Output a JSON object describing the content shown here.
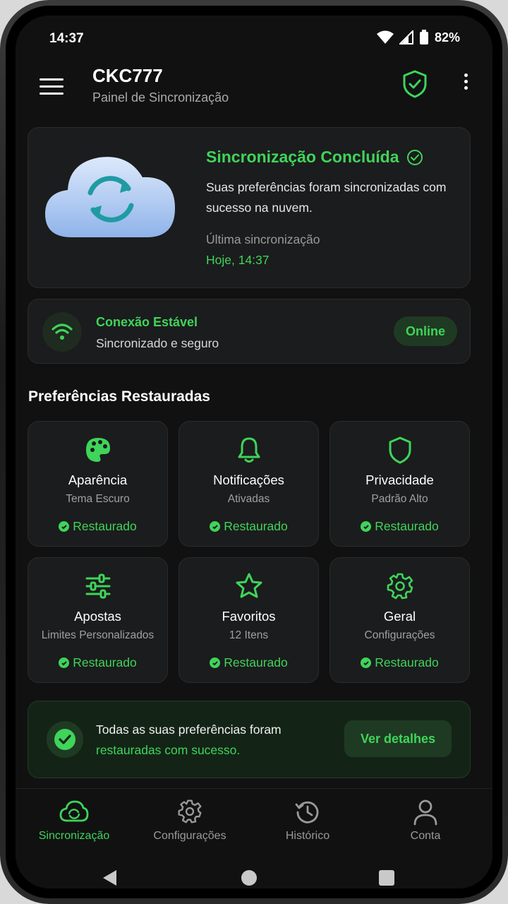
{
  "status_bar": {
    "time": "14:37",
    "battery": "82%"
  },
  "app_bar": {
    "title": "CKC777",
    "subtitle": "Painel de Sincronização"
  },
  "hero": {
    "title": "Sincronização Concluída",
    "description": "Suas preferências foram sincronizadas com sucesso na nuvem.",
    "last_sync_label": "Última sincronização",
    "last_sync_value": "Hoje, 14:37"
  },
  "connection": {
    "title": "Conexão Estável",
    "subtitle": "Sincronizado e seguro",
    "badge": "Online"
  },
  "preferences": {
    "section_title": "Preferências Restauradas",
    "items": [
      {
        "name": "Aparência",
        "value": "Tema Escuro",
        "status": "Restaurado",
        "icon": "palette-icon"
      },
      {
        "name": "Notificações",
        "value": "Ativadas",
        "status": "Restaurado",
        "icon": "bell-icon"
      },
      {
        "name": "Privacidade",
        "value": "Padrão Alto",
        "status": "Restaurado",
        "icon": "shield-icon"
      },
      {
        "name": "Apostas",
        "value": "Limites Personalizados",
        "status": "Restaurado",
        "icon": "sliders-icon"
      },
      {
        "name": "Favoritos",
        "value": "12 Itens",
        "status": "Restaurado",
        "icon": "star-icon"
      },
      {
        "name": "Geral",
        "value": "Configurações",
        "status": "Restaurado",
        "icon": "gear-icon"
      }
    ]
  },
  "success_banner": {
    "line1": "Todas as suas preferências foram",
    "line2": "restauradas com sucesso.",
    "button": "Ver detalhes"
  },
  "bottom_nav": [
    {
      "label": "Sincronização",
      "icon": "cloud-sync-icon",
      "active": true
    },
    {
      "label": "Configurações",
      "icon": "gear-icon",
      "active": false
    },
    {
      "label": "Histórico",
      "icon": "history-icon",
      "active": false
    },
    {
      "label": "Conta",
      "icon": "user-icon",
      "active": false
    }
  ],
  "colors": {
    "accent": "#3fd45a",
    "background": "#111112",
    "card": "#1b1c1d"
  }
}
